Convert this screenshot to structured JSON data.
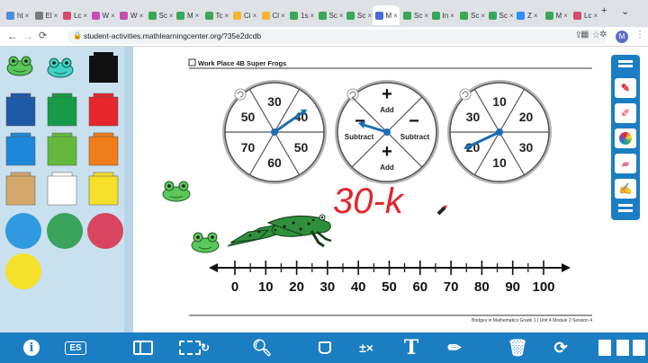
{
  "browser": {
    "tabs": [
      {
        "label": "ht",
        "color": "#4a8fd8"
      },
      {
        "label": "El",
        "color": "#7a7a7a"
      },
      {
        "label": "Lc",
        "color": "#d24b6b"
      },
      {
        "label": "W",
        "color": "#c44fb0"
      },
      {
        "label": "W",
        "color": "#c44fb0"
      },
      {
        "label": "Sc",
        "color": "#3aa757"
      },
      {
        "label": "M",
        "color": "#3aa757"
      },
      {
        "label": "Tc",
        "color": "#3aa757"
      },
      {
        "label": "Ci",
        "color": "#f2b630"
      },
      {
        "label": "Cl",
        "color": "#f2b630"
      },
      {
        "label": "1s",
        "color": "#3aa757"
      },
      {
        "label": "Sc",
        "color": "#3aa757"
      },
      {
        "label": "Sc",
        "color": "#3aa757"
      },
      {
        "label": "M",
        "color": "#4a6bd8"
      },
      {
        "label": "Sc",
        "color": "#3aa757"
      },
      {
        "label": "In",
        "color": "#3aa757"
      },
      {
        "label": "Sc",
        "color": "#3aa757"
      },
      {
        "label": "Sc",
        "color": "#3aa757"
      },
      {
        "label": "Z",
        "color": "#2d8cff"
      },
      {
        "label": "M",
        "color": "#3aa757"
      },
      {
        "label": "Lc",
        "color": "#d24b6b"
      }
    ],
    "url": "student-activities.mathlearningcenter.org/?35e2dcdb",
    "profile_initial": "M"
  },
  "worksheet": {
    "header": "Work Place 4B Super Frogs",
    "footer": "Bridges in Mathematics Grade 1 | Unit 4 Module 2 Session 4",
    "spinners": [
      {
        "name": "spinner-tens-left",
        "labels": [
          "30",
          "40",
          "50",
          "60",
          "70",
          "50"
        ],
        "hand_angle": -35
      },
      {
        "name": "spinner-operation",
        "labels": [
          "Add",
          "Subtract",
          "Add",
          "Subtract"
        ],
        "signs": [
          "+",
          "−",
          "+",
          "−"
        ],
        "hand_angle": -100
      },
      {
        "name": "spinner-tens-right",
        "labels": [
          "10",
          "20",
          "30",
          "10",
          "20",
          "30"
        ],
        "hand_angle": 155
      }
    ],
    "handwriting": "30-k",
    "number_line": [
      "0",
      "10",
      "20",
      "30",
      "40",
      "50",
      "60",
      "70",
      "80",
      "90",
      "100"
    ]
  },
  "palette": {
    "colors": [
      "#1e5aa8",
      "#179b48",
      "#e5262d",
      "#1e88d8",
      "#64b93d",
      "#ef7d1a",
      "#d4a86b",
      "#ffffff",
      "#f6e02a",
      "#2f9ae0",
      "#3aa35c",
      "#d9445e",
      "#f5e12a"
    ]
  },
  "bottom_toolbar": {
    "es_label": "ES",
    "info_icon": "info-icon"
  }
}
